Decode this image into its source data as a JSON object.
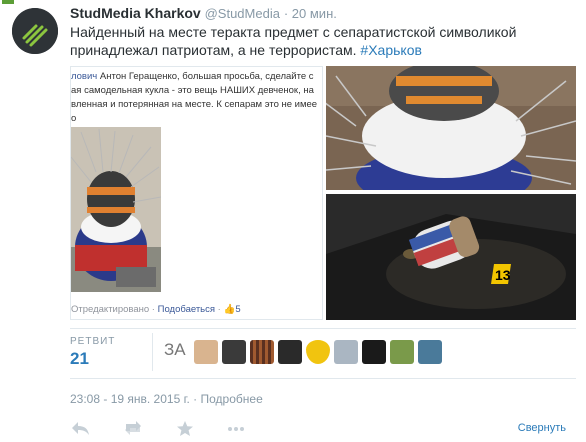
{
  "tweet": {
    "author_name": "StudMedia Kharkov",
    "author_handle": "@StudMedia",
    "time_ago": "20 мин.",
    "text": "Найденный на месте теракта предмет с сепаратистской символикой принадлежал патриотам, а не террористам.",
    "hashtag": "#Харьков"
  },
  "media": {
    "fb_post_lines": [
      "ловичАнтон Геращенко, большая просьба, сделайте с",
      "ая самодельная кукла - это вещь НАШИХ девченок, на",
      "вленная и потерянная на месте. К сепарам это не имее",
      "о"
    ],
    "fb_author_fragment": "лович",
    "fb_footer_edited": "Отредактировано",
    "fb_footer_like": "Подобаеться",
    "fb_footer_likes": "5",
    "evidence_marker": "13"
  },
  "stats": {
    "retweets_label": "РЕТВИТ",
    "retweets_count": "21",
    "rt_avatar_text": "ЗА",
    "rt_avatar_colors": [
      "#f2f2f2",
      "#d9b48f",
      "#3a3a3a",
      "#5a3020",
      "#2a2a2a",
      "#f1c40f",
      "#8a9aa8",
      "#1a1a1a",
      "#7a9a4a",
      "#4a7a9a"
    ]
  },
  "meta": {
    "date_text": "23:08 - 19 янв. 2015 г.",
    "separator": "·",
    "details_link": "Подробнее"
  },
  "actions": {
    "collapse_label": "Свернуть"
  }
}
